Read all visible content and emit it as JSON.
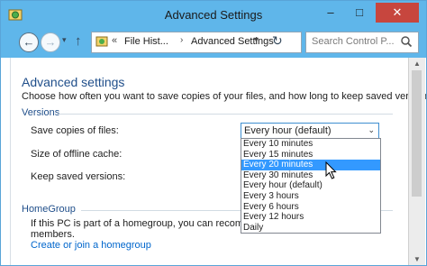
{
  "window": {
    "title": "Advanced Settings",
    "controls": {
      "minimize": "–",
      "maximize": "□",
      "close": "✕"
    }
  },
  "nav": {
    "back": "←",
    "forward": "→",
    "recent": "▾",
    "up": "↑",
    "address_prefix": "«",
    "breadcrumbs": [
      "File Hist...",
      "Advanced Settings"
    ],
    "crumb_separator": "›",
    "dropdown": "▾",
    "refresh": "↻",
    "search_placeholder": "Search Control P..."
  },
  "page": {
    "heading": "Advanced settings",
    "description": "Choose how often you want to save copies of your files, and how long to keep saved versions."
  },
  "versions": {
    "section_title": "Versions",
    "save_copies_label": "Save copies of files:",
    "offline_cache_label": "Size of offline cache:",
    "keep_versions_label": "Keep saved versions:",
    "selected_value": "Every hour (default)",
    "arrow": "⌄",
    "options": [
      "Every 10 minutes",
      "Every 15 minutes",
      "Every 20 minutes",
      "Every 30 minutes",
      "Every hour (default)",
      "Every 3 hours",
      "Every 6 hours",
      "Every 12 hours",
      "Daily"
    ],
    "highlighted_index": 2
  },
  "homegroup": {
    "section_title": "HomeGroup",
    "text_line1": "If this PC is part of a homegroup, you can recommend this",
    "text_line2": "members.",
    "link": "Create or join a homegroup"
  },
  "scrollbar": {
    "up": "▲",
    "down": "▼"
  },
  "colors": {
    "titlebar": "#5fb6ea",
    "close_button": "#c7463e",
    "accent_text": "#1f4e8a",
    "link": "#0066cc",
    "highlight": "#3399ff"
  }
}
